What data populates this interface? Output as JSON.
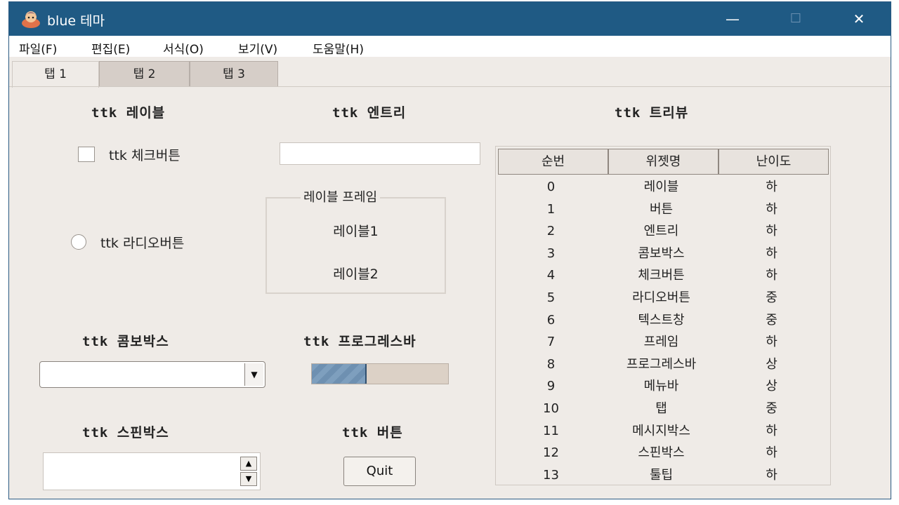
{
  "window": {
    "title": "blue 테마",
    "controls": {
      "minimize": "—",
      "maximize": "☐",
      "close": "✕"
    }
  },
  "menu": [
    "파일(F)",
    "편집(E)",
    "서식(O)",
    "보기(V)",
    "도움말(H)"
  ],
  "tabs": [
    "탭 1",
    "탭 2",
    "탭 3"
  ],
  "labels": {
    "ttk_label": "ttk 레이블",
    "ttk_entry": "ttk 엔트리",
    "ttk_treeview": "ttk 트리뷰",
    "ttk_combobox": "ttk 콤보박스",
    "ttk_progressbar": "ttk 프로그레스바",
    "ttk_spinbox": "ttk 스핀박스",
    "ttk_button": "ttk 버튼"
  },
  "checkbox": {
    "label": "ttk 체크버튼",
    "checked": false
  },
  "radio": {
    "label": "ttk 라디오버튼",
    "selected": false
  },
  "entry": {
    "value": ""
  },
  "label_frame": {
    "title": "레이블 프레임",
    "label1": "레이블1",
    "label2": "레이블2"
  },
  "combobox": {
    "value": "",
    "arrow_icon": "▼"
  },
  "progress": {
    "value_percent": 40
  },
  "spinbox": {
    "value": "",
    "up_icon": "▲",
    "down_icon": "▼"
  },
  "quit_button": {
    "label": "Quit"
  },
  "treeview": {
    "columns": [
      "순번",
      "위젯명",
      "난이도"
    ],
    "rows": [
      [
        "0",
        "레이블",
        "하"
      ],
      [
        "1",
        "버튼",
        "하"
      ],
      [
        "2",
        "엔트리",
        "하"
      ],
      [
        "3",
        "콤보박스",
        "하"
      ],
      [
        "4",
        "체크버튼",
        "하"
      ],
      [
        "5",
        "라디오버튼",
        "중"
      ],
      [
        "6",
        "텍스트창",
        "중"
      ],
      [
        "7",
        "프레임",
        "하"
      ],
      [
        "8",
        "프로그레스바",
        "상"
      ],
      [
        "9",
        "메뉴바",
        "상"
      ],
      [
        "10",
        "탭",
        "중"
      ],
      [
        "11",
        "메시지박스",
        "하"
      ],
      [
        "12",
        "스핀박스",
        "하"
      ],
      [
        "13",
        "툴팁",
        "하"
      ]
    ]
  }
}
